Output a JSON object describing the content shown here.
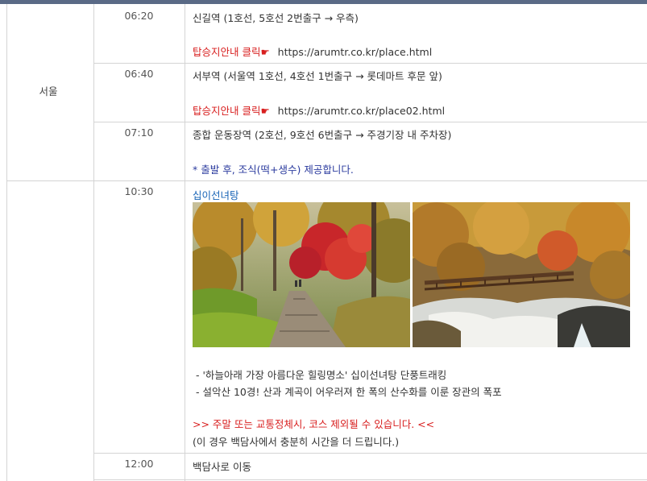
{
  "region": "서울",
  "rows": [
    {
      "time": "06:20",
      "line1": "신길역 (1호선, 5호선 2번출구 → 우측)",
      "link_label": "탑승지안내 클릭☛",
      "link_url": "https://arumtr.co.kr/place.html"
    },
    {
      "time": "06:40",
      "line1": "서부역 (서울역 1호선, 4호선 1번출구 → 롯데마트 후문 앞)",
      "link_label": "탑승지안내 클릭☛",
      "link_url": "https://arumtr.co.kr/place02.html"
    },
    {
      "time": "07:10",
      "line1": "종합 운동장역 (2호선, 9호선 6번출구 → 주경기장 내 주차장)",
      "note": "* 출발 후, 조식(떡+생수) 제공합니다."
    }
  ],
  "spot": {
    "time": "10:30",
    "title": "십이선녀탕",
    "bullet1": "- '하늘아래 가장 아름다운 힐링명소' 십이선녀탕 단풍트래킹",
    "bullet2": "-  설악산 10경! 산과 계곡이 어우러져 한 폭의 산수화를 이룬 장관의 폭포",
    "warning": ">> 주말 또는 교통정체시, 코스 제외될 수 있습니다. <<",
    "warning_sub": "(이 경우 백담사에서 충분히 시간을 더 드립니다.)",
    "photo_left": "autumn-forest-trail-photo",
    "photo_right": "valley-bridge-photo"
  },
  "last": {
    "time": "12:00",
    "text": "백담사로 이동"
  },
  "colors": {
    "accent_red": "#d81e1e",
    "note_blue": "#2a3a9e",
    "title_blue": "#1763b6",
    "border": "#d4d4d4",
    "topbar": "#5a6a86"
  }
}
